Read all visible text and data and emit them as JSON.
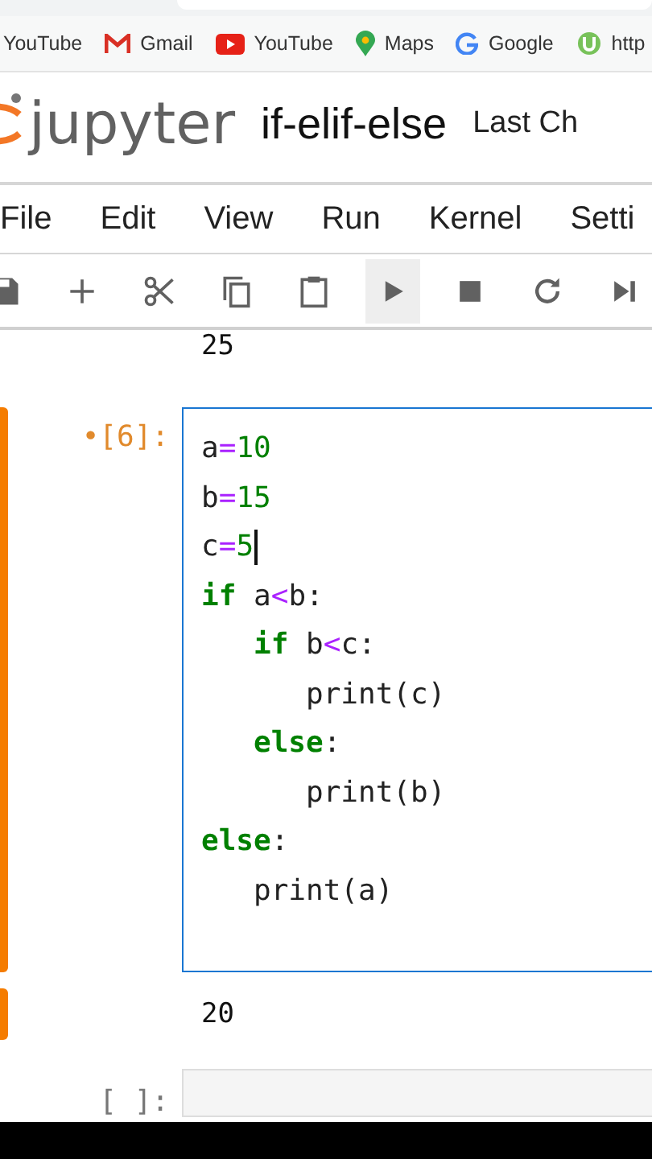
{
  "bookmarks": [
    {
      "label": "YouTube",
      "kind": "video-partial"
    },
    {
      "label": "Gmail",
      "kind": "mail"
    },
    {
      "label": "YouTube",
      "kind": "video"
    },
    {
      "label": "Maps",
      "kind": "pin"
    },
    {
      "label": "Google",
      "kind": "search"
    },
    {
      "label": "http",
      "kind": "circle"
    }
  ],
  "header": {
    "logo": "jupyter",
    "notebook_title": "if-elif-else",
    "checkpoint": "Last Ch"
  },
  "menu": [
    "File",
    "Edit",
    "View",
    "Run",
    "Kernel",
    "Setti"
  ],
  "toolbar": [
    {
      "kind": "save"
    },
    {
      "kind": "add"
    },
    {
      "kind": "cut"
    },
    {
      "kind": "copy"
    },
    {
      "kind": "paste"
    },
    {
      "kind": "run",
      "selected": true
    },
    {
      "kind": "stop"
    },
    {
      "kind": "restart"
    },
    {
      "kind": "fastforward"
    }
  ],
  "previous_output": "25",
  "cell": {
    "prompt": "•[6]:",
    "selected": true,
    "lines": [
      [
        {
          "kind": "name",
          "text": "a"
        },
        {
          "kind": "op",
          "text": "="
        },
        {
          "kind": "num",
          "text": "10"
        }
      ],
      [
        {
          "kind": "name",
          "text": "b"
        },
        {
          "kind": "op",
          "text": "="
        },
        {
          "kind": "num",
          "text": "15"
        }
      ],
      [
        {
          "kind": "name",
          "text": "c"
        },
        {
          "kind": "op",
          "text": "="
        },
        {
          "kind": "num",
          "text": "5"
        },
        {
          "kind": "cursor"
        }
      ],
      [
        {
          "kind": "kw",
          "text": "if"
        },
        {
          "kind": "name",
          "text": " a"
        },
        {
          "kind": "op",
          "text": "<"
        },
        {
          "kind": "name",
          "text": "b:"
        }
      ],
      [
        {
          "kind": "indent"
        },
        {
          "kind": "kw",
          "text": "if"
        },
        {
          "kind": "name",
          "text": " b"
        },
        {
          "kind": "op",
          "text": "<"
        },
        {
          "kind": "name",
          "text": "c:"
        }
      ],
      [
        {
          "kind": "indent"
        },
        {
          "kind": "indent"
        },
        {
          "kind": "name",
          "text": "print(c)"
        }
      ],
      [
        {
          "kind": "indent"
        },
        {
          "kind": "kw",
          "text": "else"
        },
        {
          "kind": "name",
          "text": ":"
        }
      ],
      [
        {
          "kind": "indent"
        },
        {
          "kind": "indent"
        },
        {
          "kind": "name",
          "text": "print(b)"
        }
      ],
      [
        {
          "kind": "kw",
          "text": "else"
        },
        {
          "kind": "name",
          "text": ":"
        }
      ],
      [
        {
          "kind": "indent"
        },
        {
          "kind": "name",
          "text": "print(a)"
        }
      ]
    ],
    "output": "20"
  },
  "next_cell": {
    "prompt": "[ ]:"
  }
}
